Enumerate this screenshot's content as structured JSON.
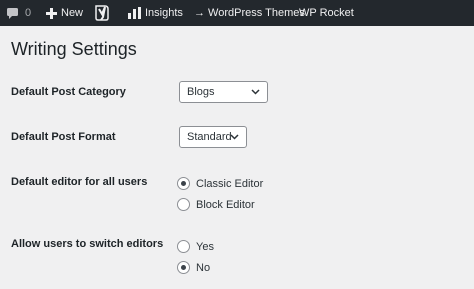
{
  "adminbar": {
    "comment_count": "0",
    "new_label": "New",
    "insights_label": "Insights",
    "themes_label": "→ WordPress Themes",
    "rocket_label": "WP Rocket"
  },
  "page": {
    "title": "Writing Settings"
  },
  "settings": {
    "category": {
      "label": "Default Post Category",
      "value": "Blogs"
    },
    "format": {
      "label": "Default Post Format",
      "value": "Standard"
    },
    "editor": {
      "label": "Default editor for all users",
      "options": [
        "Classic Editor",
        "Block Editor"
      ],
      "selected": "Classic Editor"
    },
    "switch": {
      "label": "Allow users to switch editors",
      "options": [
        "Yes",
        "No"
      ],
      "selected": "No"
    }
  }
}
